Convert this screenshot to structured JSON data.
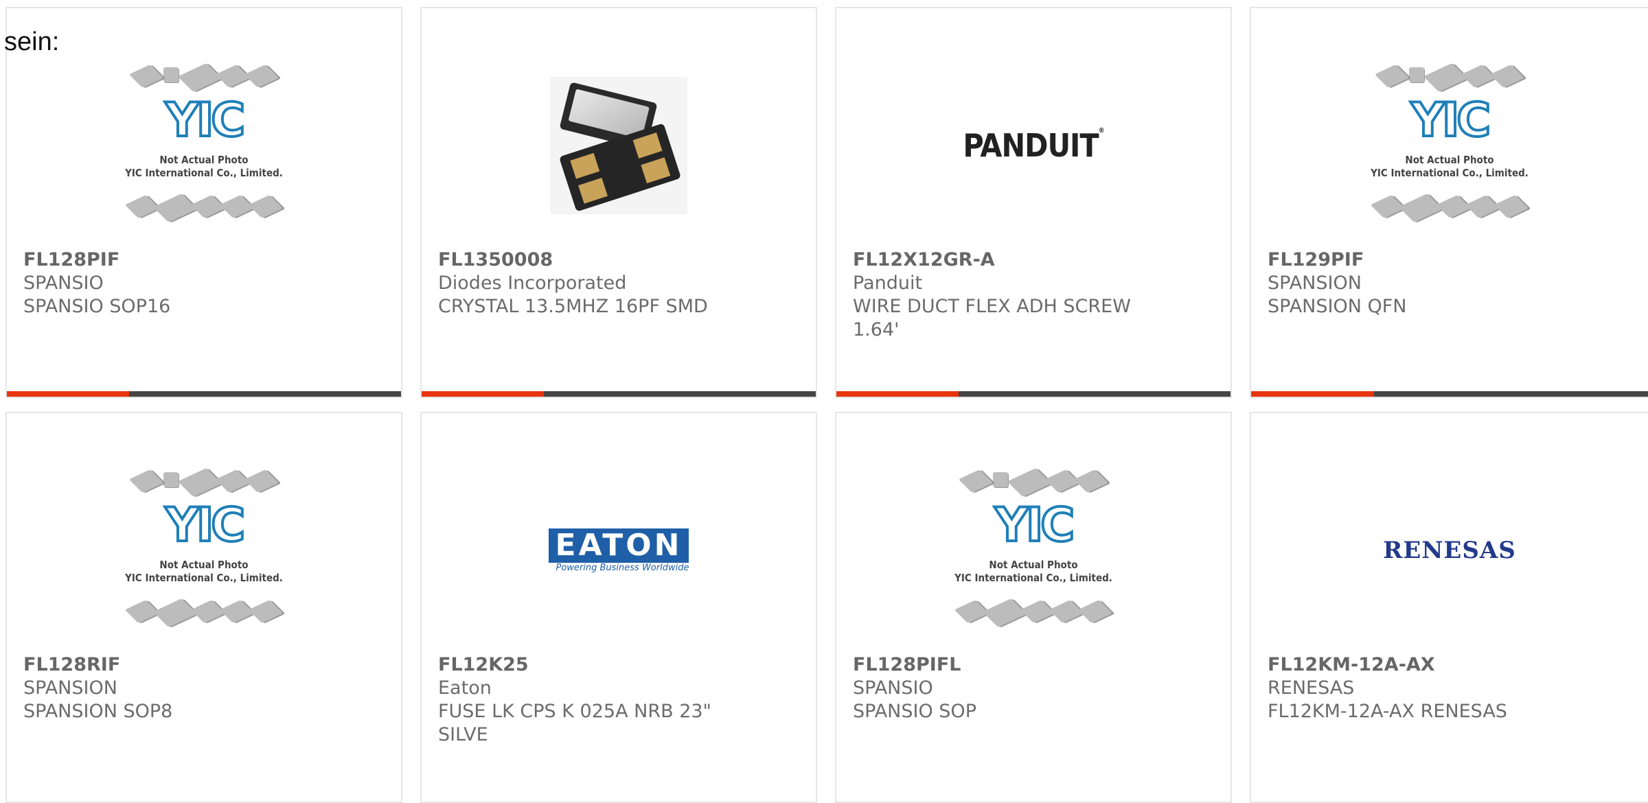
{
  "lead_text": "sein:",
  "colors": {
    "accent": "#e8350f",
    "bar": "#454545",
    "yic_blue": "#1f7fb8"
  },
  "placeholder": {
    "logo": "YIC",
    "line1": "Not Actual Photo",
    "line2": "YIC International Co., Limited."
  },
  "brand_logos": {
    "panduit": "PANDUIT",
    "eaton": "EATON",
    "eaton_tagline": "Powering Business Worldwide",
    "renesas": "RENESAS"
  },
  "products": [
    {
      "pn": "FL128PIF",
      "mfr": "SPANSIO",
      "desc": "SPANSIO SOP16",
      "image": "yic-placeholder-icon"
    },
    {
      "pn": "FL1350008",
      "mfr": "Diodes Incorporated",
      "desc": "CRYSTAL 13.5MHZ 16PF SMD",
      "image": "crystal-photo-icon"
    },
    {
      "pn": "FL12X12GR-A",
      "mfr": "Panduit",
      "desc": "WIRE DUCT FLEX ADH SCREW 1.64'",
      "image": "panduit-logo"
    },
    {
      "pn": "FL129PIF",
      "mfr": "SPANSION",
      "desc": "SPANSION QFN",
      "image": "yic-placeholder-icon"
    },
    {
      "pn": "FL128RIF",
      "mfr": "SPANSION",
      "desc": "SPANSION SOP8",
      "image": "yic-placeholder-icon"
    },
    {
      "pn": "FL12K25",
      "mfr": "Eaton",
      "desc": "FUSE LK CPS K 025A NRB 23\" SILVE",
      "image": "eaton-logo"
    },
    {
      "pn": "FL128PIFL",
      "mfr": "SPANSIO",
      "desc": "SPANSIO SOP",
      "image": "yic-placeholder-icon"
    },
    {
      "pn": "FL12KM-12A-AX",
      "mfr": "RENESAS",
      "desc": "FL12KM-12A-AX RENESAS",
      "image": "renesas-logo"
    }
  ]
}
